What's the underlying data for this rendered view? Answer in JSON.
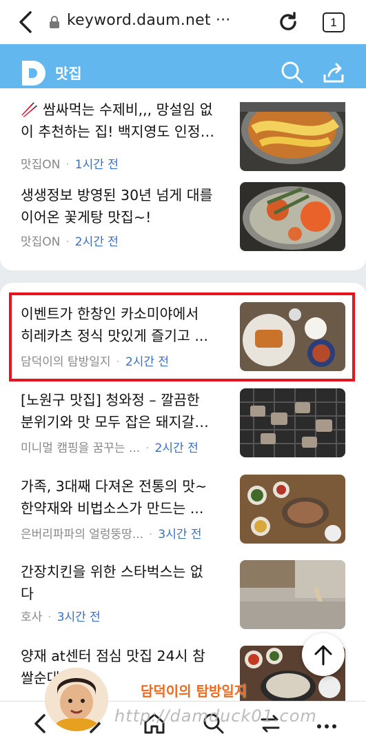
{
  "browser": {
    "url": "keyword.daum.net ···",
    "tab_count": "1"
  },
  "header": {
    "section_title": "맛집"
  },
  "card1": {
    "items": [
      {
        "title_line1": "🥢 쌈싸먹는 수제비,,, 망설임 없",
        "title_line2": "이 추천하는 집! 백지영도 인정…",
        "source": "맛집ON",
        "time": "1시간 전"
      },
      {
        "title_line1": "생생정보 방영된 30년 넘게 대를",
        "title_line2": "이어온 꽃게탕 맛집~!",
        "source": "맛집ON",
        "time": "2시간 전"
      }
    ]
  },
  "card2": {
    "items": [
      {
        "title_line1": "이벤트가 한창인 카소미야에서",
        "title_line2": "히레카츠 정식 맛있게 즐기고 ...",
        "source": "담덕이의 탐방일지",
        "time": "2시간 전"
      },
      {
        "title_line1": "[노원구 맛집] 청와정 – 깔끔한",
        "title_line2": "분위기와 맛 모두 잡은 돼지갈…",
        "source": "미니멀 캠핑을 꿈꾸는 ...",
        "time": "2시간 전"
      },
      {
        "title_line1": "가족, 3대째 다져온 전통의 맛~",
        "title_line2": "한약재와 비법소스가 만드는 ...",
        "source": "은버리파파의 얼렁뚱땅...",
        "time": "3시간 전"
      },
      {
        "title_line1": "간장치킨을 위한 스타벅스는 없",
        "title_line2": "다",
        "source": "호사",
        "time": "3시간 전"
      },
      {
        "title_line1": "양재 at센터 점심 맛집 24시 참",
        "title_line2": "쌀순대국",
        "source": "",
        "time": ""
      }
    ]
  },
  "overlay": {
    "watermark_text": "담덕이의 탐방일지",
    "watermark_url": "http://damduck01.com"
  },
  "colors": {
    "header_blue": "#63b7ef",
    "time_blue": "#3a6fc4",
    "highlight_red": "#e8141b"
  },
  "icons": [
    "back-icon",
    "lock-icon",
    "reload-icon",
    "tabs-icon",
    "daum-logo",
    "search-icon",
    "share-icon",
    "scroll-top-icon",
    "home-icon",
    "bookmark-icon",
    "menu-icon"
  ]
}
